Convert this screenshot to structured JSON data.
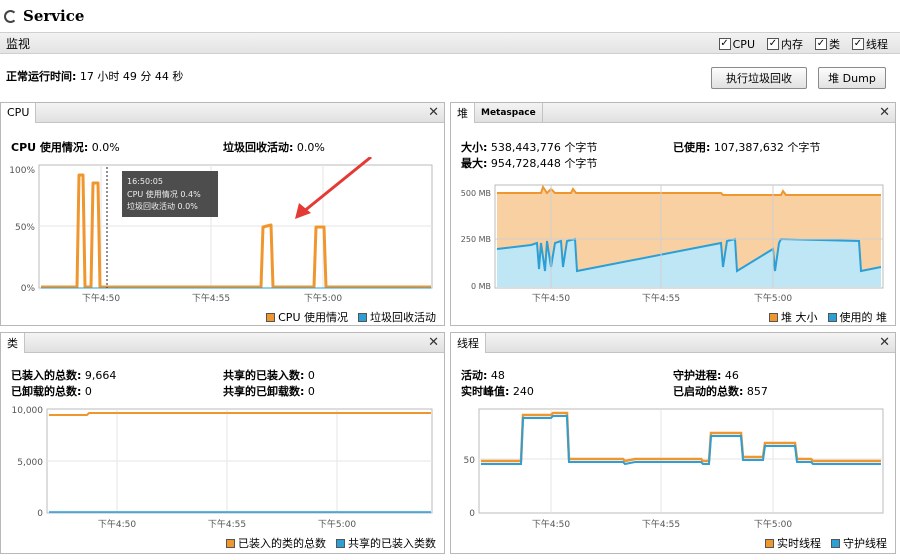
{
  "window": {
    "title": "Service"
  },
  "monitor": {
    "label": "监视",
    "checks": [
      {
        "label": "CPU",
        "checked": true
      },
      {
        "label": "内存",
        "checked": true
      },
      {
        "label": "类",
        "checked": true
      },
      {
        "label": "线程",
        "checked": true
      }
    ]
  },
  "uptime": {
    "label": "正常运行时间:",
    "value": "17 小时 49 分 44 秒"
  },
  "buttons": {
    "gc": "执行垃圾回收",
    "dump": "堆 Dump"
  },
  "cpu": {
    "title": "CPU",
    "usage_label": "CPU 使用情况:",
    "usage_value": "0.0%",
    "gc_label": "垃圾回收活动:",
    "gc_value": "0.0%",
    "y_ticks": [
      "100%",
      "50%",
      "0%"
    ],
    "x_ticks": [
      "下午4:50",
      "下午4:55",
      "下午5:00"
    ],
    "tooltip": {
      "time": "16:50:05",
      "l1": "CPU 使用情况  0.4%",
      "l2": "垃圾回收活动  0.0%"
    },
    "legend": [
      "CPU 使用情况",
      "垃圾回收活动"
    ]
  },
  "heap": {
    "tabs": [
      "堆",
      "Metaspace"
    ],
    "size_label": "大小:",
    "size_value": "538,443,776 个字节",
    "max_label": "最大:",
    "max_value": "954,728,448 个字节",
    "used_label": "已使用:",
    "used_value": "107,387,632 个字节",
    "y_ticks": [
      "500 MB",
      "250 MB",
      "0 MB"
    ],
    "x_ticks": [
      "下午4:50",
      "下午4:55",
      "下午5:00"
    ],
    "legend": [
      "堆 大小",
      "使用的 堆"
    ]
  },
  "classes": {
    "title": "类",
    "loaded_label": "已装入的总数:",
    "loaded_value": "9,664",
    "unloaded_label": "已卸载的总数:",
    "unloaded_value": "0",
    "shared_loaded_label": "共享的已装入数:",
    "shared_loaded_value": "0",
    "shared_unloaded_label": "共享的已卸载数:",
    "shared_unloaded_value": "0",
    "y_ticks": [
      "10,000",
      "5,000",
      "0"
    ],
    "x_ticks": [
      "下午4:50",
      "下午4:55",
      "下午5:00"
    ],
    "legend": [
      "已装入的类的总数",
      "共享的已装入类数"
    ]
  },
  "threads": {
    "title": "线程",
    "live_label": "活动:",
    "live_value": "48",
    "peak_label": "实时峰值:",
    "peak_value": "240",
    "daemon_label": "守护进程:",
    "daemon_value": "46",
    "started_label": "已启动的总数:",
    "started_value": "857",
    "y_ticks": [
      "50",
      "0"
    ],
    "x_ticks": [
      "下午4:50",
      "下午4:55",
      "下午5:00"
    ],
    "legend": [
      "实时线程",
      "守护线程"
    ]
  },
  "colors": {
    "orange": "#f0962e",
    "blue": "#2b9fd6",
    "heap_fill": "#f7c48a",
    "used_fill": "#bfe6f5"
  }
}
